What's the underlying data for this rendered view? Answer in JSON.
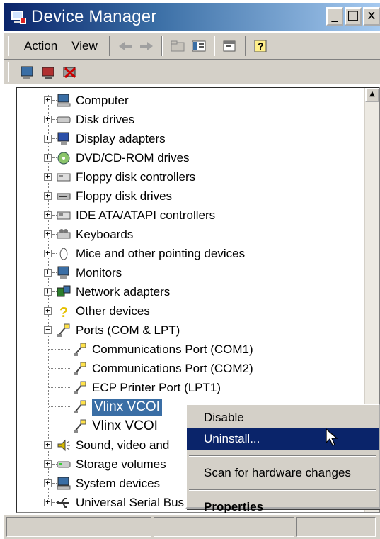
{
  "window": {
    "title": "Device Manager",
    "min_glyph": "_",
    "max_glyph": "□",
    "close_glyph": "x"
  },
  "menu": {
    "action": "Action",
    "view": "View"
  },
  "tree": {
    "items": [
      {
        "label": "Computer",
        "icon": "computer-icon"
      },
      {
        "label": "Disk drives",
        "icon": "disk-drive-icon"
      },
      {
        "label": "Display adapters",
        "icon": "display-adapter-icon"
      },
      {
        "label": "DVD/CD-ROM drives",
        "icon": "cd-rom-icon"
      },
      {
        "label": "Floppy disk controllers",
        "icon": "controller-icon"
      },
      {
        "label": "Floppy disk drives",
        "icon": "floppy-drive-icon"
      },
      {
        "label": "IDE ATA/ATAPI controllers",
        "icon": "controller-icon"
      },
      {
        "label": "Keyboards",
        "icon": "keyboard-icon"
      },
      {
        "label": "Mice and other pointing devices",
        "icon": "mouse-icon"
      },
      {
        "label": "Monitors",
        "icon": "monitor-icon"
      },
      {
        "label": "Network adapters",
        "icon": "network-icon"
      },
      {
        "label": "Other devices",
        "icon": "question-icon"
      },
      {
        "label": "Ports (COM & LPT)",
        "icon": "port-icon"
      },
      {
        "label": "Communications Port (COM1)",
        "icon": "port-icon"
      },
      {
        "label": "Communications Port (COM2)",
        "icon": "port-icon"
      },
      {
        "label": "ECP Printer Port (LPT1)",
        "icon": "port-icon"
      },
      {
        "label": "Vlinx VCOI",
        "icon": "port-icon"
      },
      {
        "label": "Vlinx VCOI",
        "icon": "port-icon"
      },
      {
        "label": "Sound, video and",
        "icon": "sound-icon"
      },
      {
        "label": "Storage volumes",
        "icon": "storage-icon"
      },
      {
        "label": "System devices",
        "icon": "system-icon"
      },
      {
        "label": "Universal Serial Bus controllers",
        "icon": "usb-icon"
      }
    ]
  },
  "context_menu": {
    "disable": "Disable",
    "uninstall": "Uninstall...",
    "scan": "Scan for hardware changes",
    "properties": "Properties"
  },
  "colors": {
    "selection": "#3a6ea5",
    "menu_highlight": "#0a246a",
    "chrome": "#d4d0c8"
  }
}
